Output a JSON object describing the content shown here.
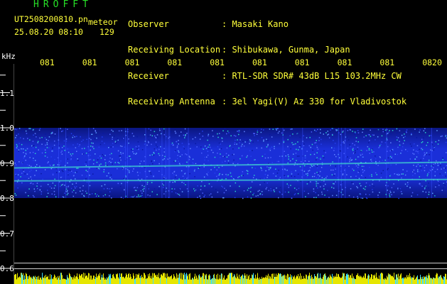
{
  "header": {
    "app_title": "HROFFT",
    "filename": "UT2508200810.pn",
    "meteor_label": "meteor",
    "datetime": "25.08.20 08:10",
    "count": "129"
  },
  "info": {
    "rows": [
      {
        "label": "Observer",
        "value": ": Masaki Kano"
      },
      {
        "label": "Receiving Location",
        "value": ": Shibukawa, Gunma, Japan"
      },
      {
        "label": "Receiver",
        "value": ": RTL-SDR SDR# 43dB L15 103.2MHz CW"
      },
      {
        "label": "Receiving Antenna",
        "value": ": 3el Yagi(V) Az 330 for Vladivostok"
      }
    ]
  },
  "axis": {
    "y_unit": "kHz",
    "y_ticks": [
      {
        "label": "1.1",
        "value": 1.1
      },
      {
        "label": "1.0",
        "value": 1.0
      },
      {
        "label": "0.9",
        "value": 0.9
      },
      {
        "label": "0.8",
        "value": 0.8
      },
      {
        "label": "0.7",
        "value": 0.7
      },
      {
        "label": "0.6",
        "value": 0.6
      }
    ],
    "y_range": [
      0.6,
      1.2
    ],
    "x_ticks": [
      "081",
      "081",
      "081",
      "081",
      "081",
      "081",
      "081",
      "081",
      "081",
      "0820"
    ]
  },
  "colors": {
    "text_yellow": "#ffff3a",
    "text_green": "#27e027",
    "grid": "#e0e0e0",
    "signal_band": "#1a2fd8",
    "signal_line": "#3fd0d0",
    "bottom_bar_yellow": "#e6e600",
    "bottom_bar_cyan": "#40e0ff"
  },
  "spectrogram": {
    "band_top_khz": 1.0,
    "band_bottom_khz": 0.8,
    "carrier_lines_khz": [
      0.89,
      0.853
    ]
  }
}
